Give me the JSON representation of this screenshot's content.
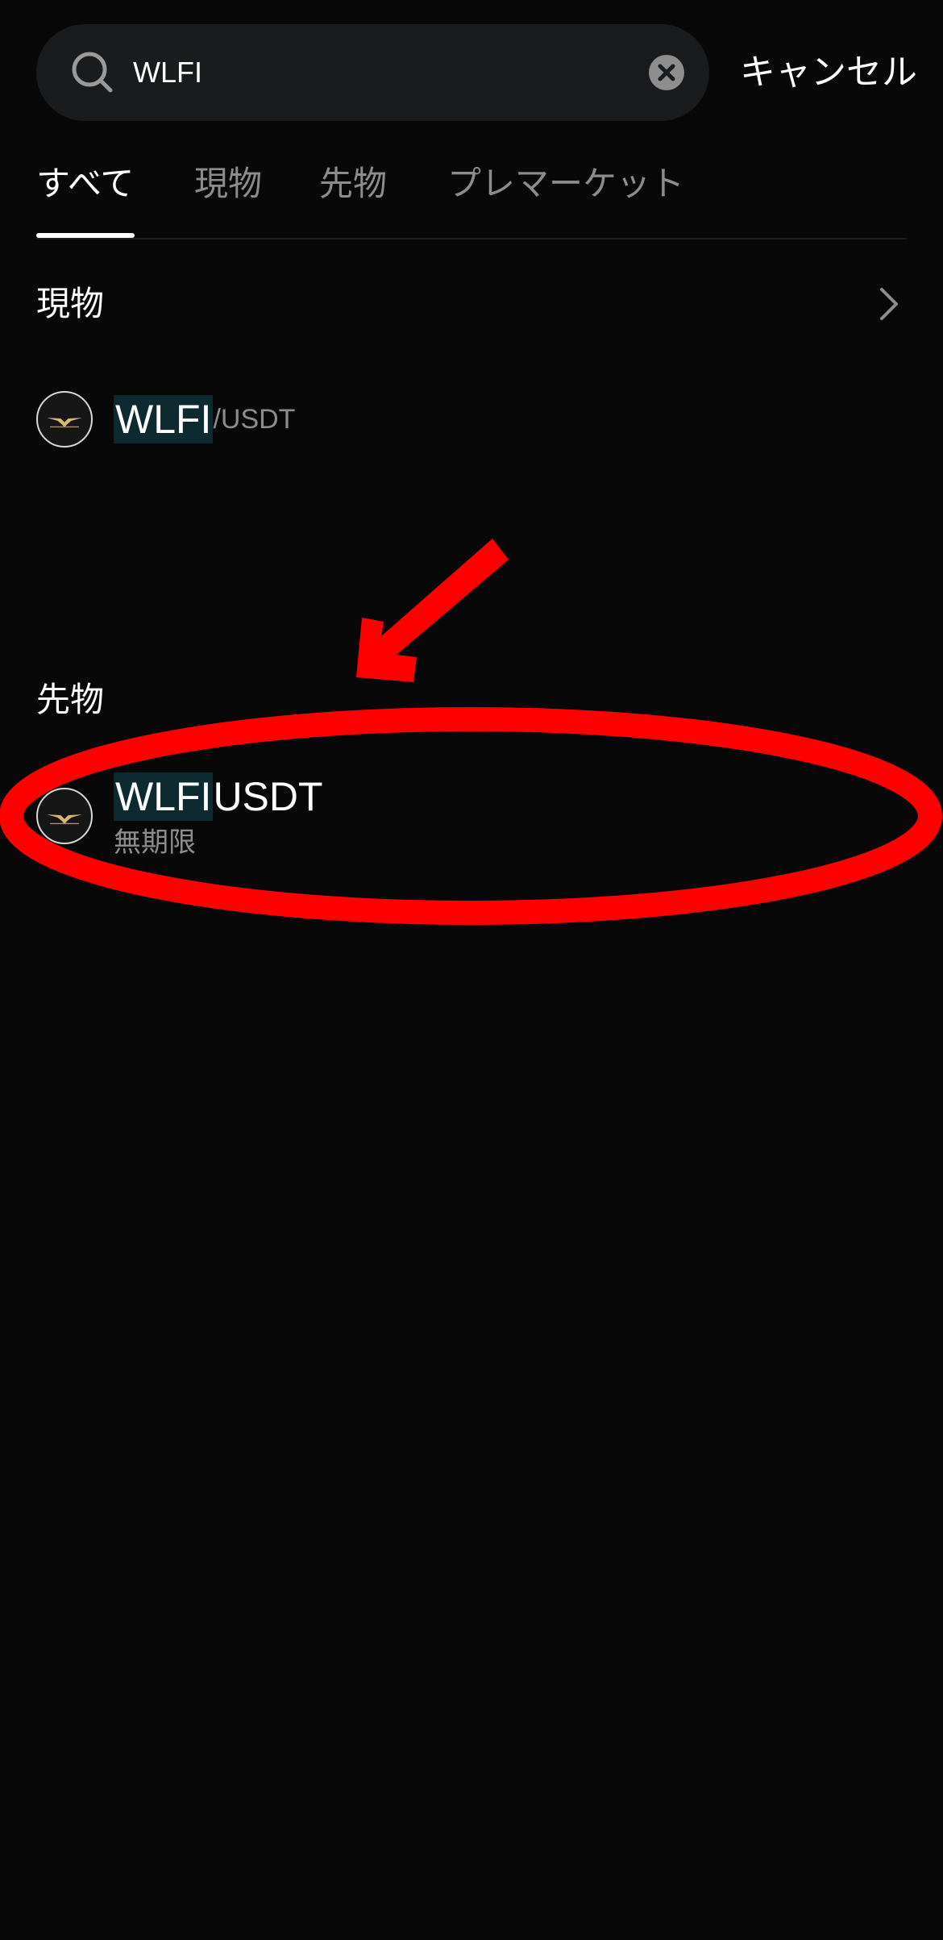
{
  "search": {
    "value": "WLFI",
    "cancel_label": "キャンセル"
  },
  "tabs": [
    {
      "label": "すべて",
      "active": true
    },
    {
      "label": "現物",
      "active": false
    },
    {
      "label": "先物",
      "active": false
    },
    {
      "label": "プレマーケット",
      "active": false
    }
  ],
  "spot": {
    "title": "現物",
    "items": [
      {
        "match": "WLFI",
        "rest": "/USDT"
      }
    ]
  },
  "futures": {
    "title": "先物",
    "items": [
      {
        "match": "WLFI",
        "rest": "USDT",
        "type": "無期限"
      }
    ]
  },
  "colors": {
    "background": "#080808",
    "search_bg": "#1a1b1d",
    "highlight_bg": "#0d2a30",
    "muted_text": "#8c8c8c",
    "annotation_red": "#ff0000"
  },
  "icons": {
    "search": "search-icon",
    "clear": "clear-icon",
    "chevron": "chevron-right-icon",
    "coin": "wlfi-eagle-logo-icon"
  }
}
